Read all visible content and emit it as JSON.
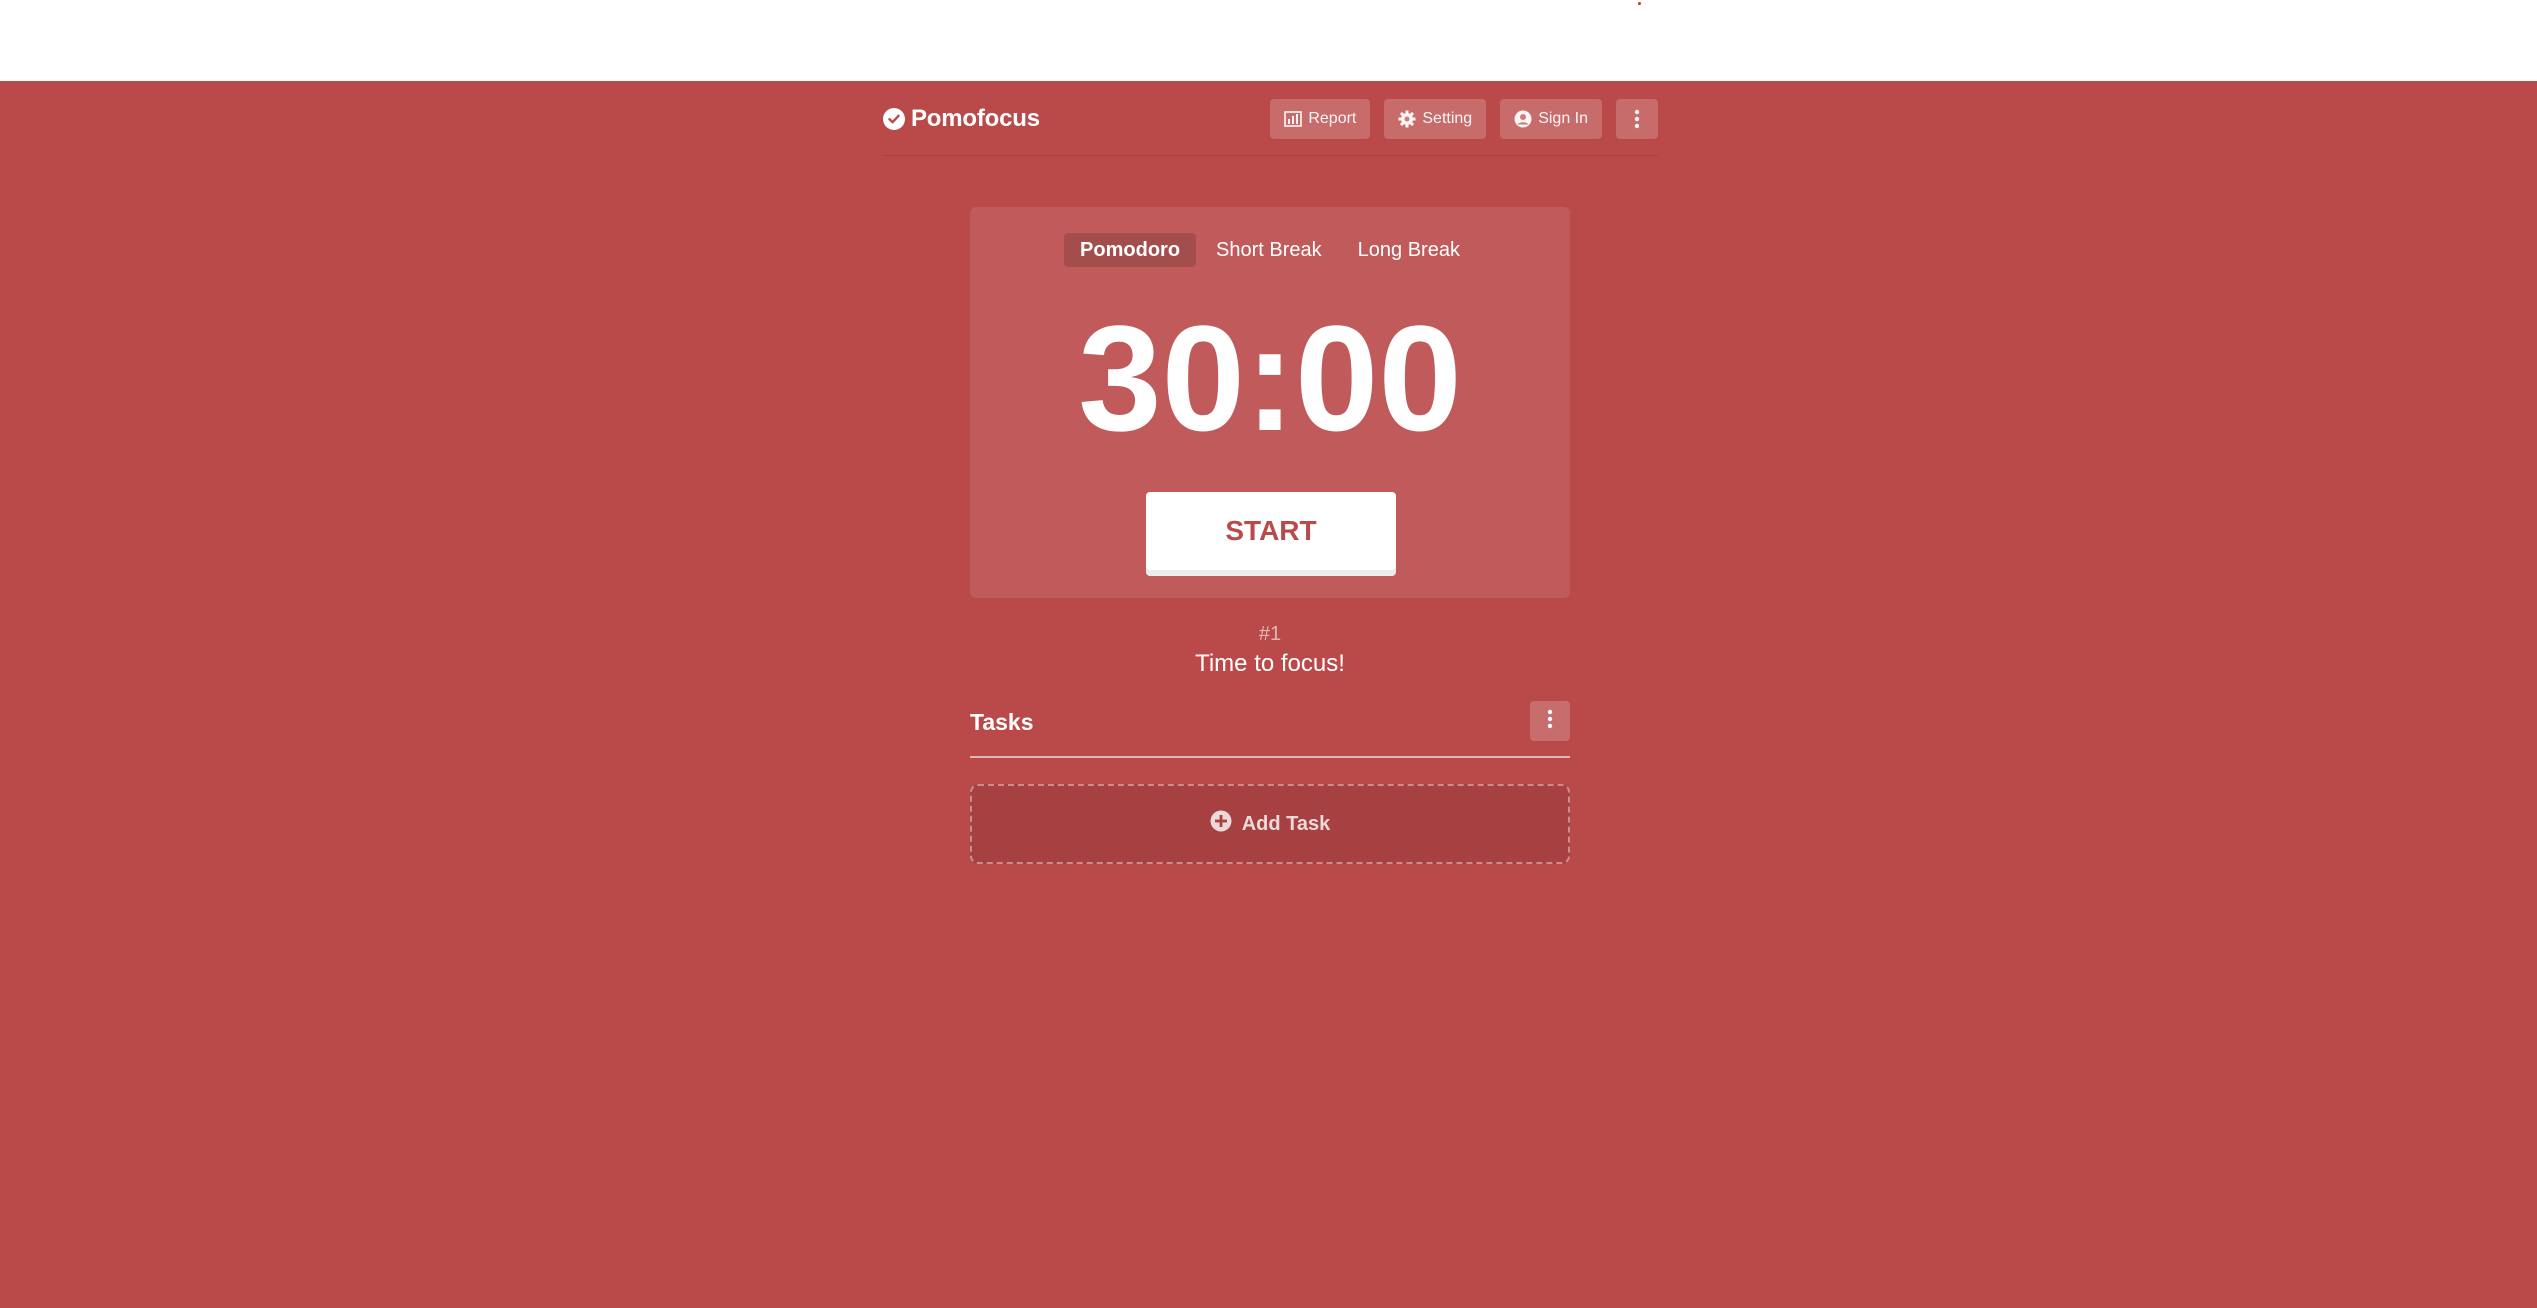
{
  "app": {
    "name": "Pomofocus",
    "background_color": "#ba4949"
  },
  "header": {
    "nav": [
      {
        "label": "Report",
        "icon": "chart-icon"
      },
      {
        "label": "Setting",
        "icon": "gear-icon"
      },
      {
        "label": "Sign In",
        "icon": "user-circle-icon"
      }
    ],
    "menu_icon": "vertical-dots-icon"
  },
  "timer": {
    "modes": [
      "Pomodoro",
      "Short Break",
      "Long Break"
    ],
    "active_mode": "Pomodoro",
    "time": "30:00",
    "start_label": "START"
  },
  "session": {
    "count": "#1",
    "message": "Time to focus!"
  },
  "tasks": {
    "title": "Tasks",
    "add_label": "Add Task",
    "add_icon": "plus-circle-icon"
  }
}
